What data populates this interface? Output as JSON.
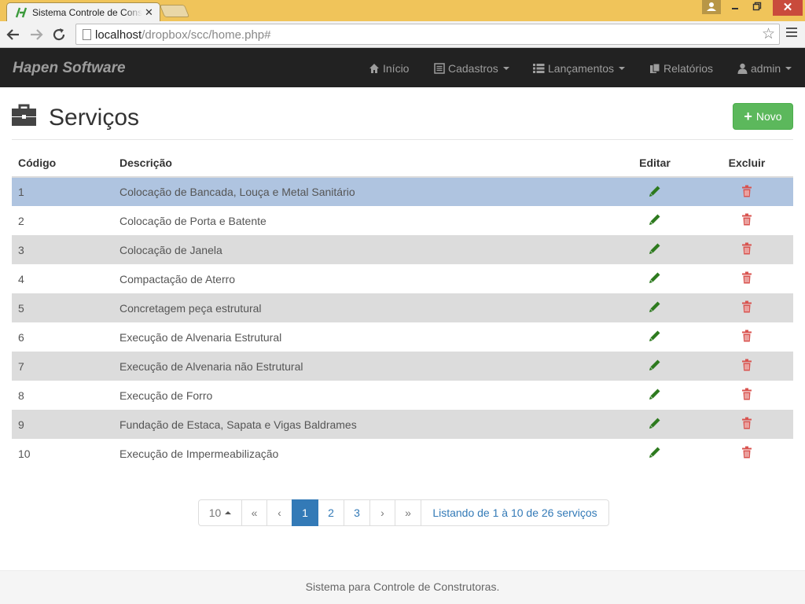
{
  "browser": {
    "tab_title": "Sistema Controle de Construtoras",
    "url_host": "localhost",
    "url_path": "/dropbox/scc/home.php#"
  },
  "navbar": {
    "brand": "Hapen Software",
    "items": [
      {
        "label": "Início",
        "icon": "home-icon"
      },
      {
        "label": "Cadastros",
        "icon": "list-alt-icon"
      },
      {
        "label": "Lançamentos",
        "icon": "th-list-icon"
      },
      {
        "label": "Relatórios",
        "icon": "duplicate-icon"
      },
      {
        "label": "admin",
        "icon": "user-icon"
      }
    ]
  },
  "header": {
    "title": "Serviços",
    "icon": "briefcase-icon",
    "new_button": "Novo"
  },
  "table": {
    "columns": [
      "Código",
      "Descrição",
      "Editar",
      "Excluir"
    ],
    "rows": [
      {
        "code": "1",
        "description": "Colocação de Bancada, Louça e Metal Sanitário"
      },
      {
        "code": "2",
        "description": "Colocação de Porta e Batente"
      },
      {
        "code": "3",
        "description": "Colocação de Janela"
      },
      {
        "code": "4",
        "description": "Compactação de Aterro"
      },
      {
        "code": "5",
        "description": "Concretagem peça estrutural"
      },
      {
        "code": "6",
        "description": "Execução de Alvenaria Estrutural"
      },
      {
        "code": "7",
        "description": "Execução de Alvenaria não Estrutural"
      },
      {
        "code": "8",
        "description": "Execução de Forro"
      },
      {
        "code": "9",
        "description": "Fundação de Estaca, Sapata e Vigas Baldrames"
      },
      {
        "code": "10",
        "description": "Execução de Impermeabilização"
      }
    ],
    "selected_row": "1"
  },
  "pagination": {
    "page_size": "10",
    "first": "«",
    "prev": "‹",
    "pages": [
      "1",
      "2",
      "3"
    ],
    "current_page": "1",
    "next": "›",
    "last": "»",
    "summary": "Listando de 1 à 10 de 26 serviços"
  },
  "footer": {
    "text": "Sistema para Controle de Construtoras."
  },
  "colors": {
    "navbar": "#222222",
    "accent": "#337ab7",
    "success": "#5cb85c",
    "edit_icon": "#2d7a1e",
    "delete_icon": "#d9534f",
    "selected_row": "#afc4e0"
  }
}
